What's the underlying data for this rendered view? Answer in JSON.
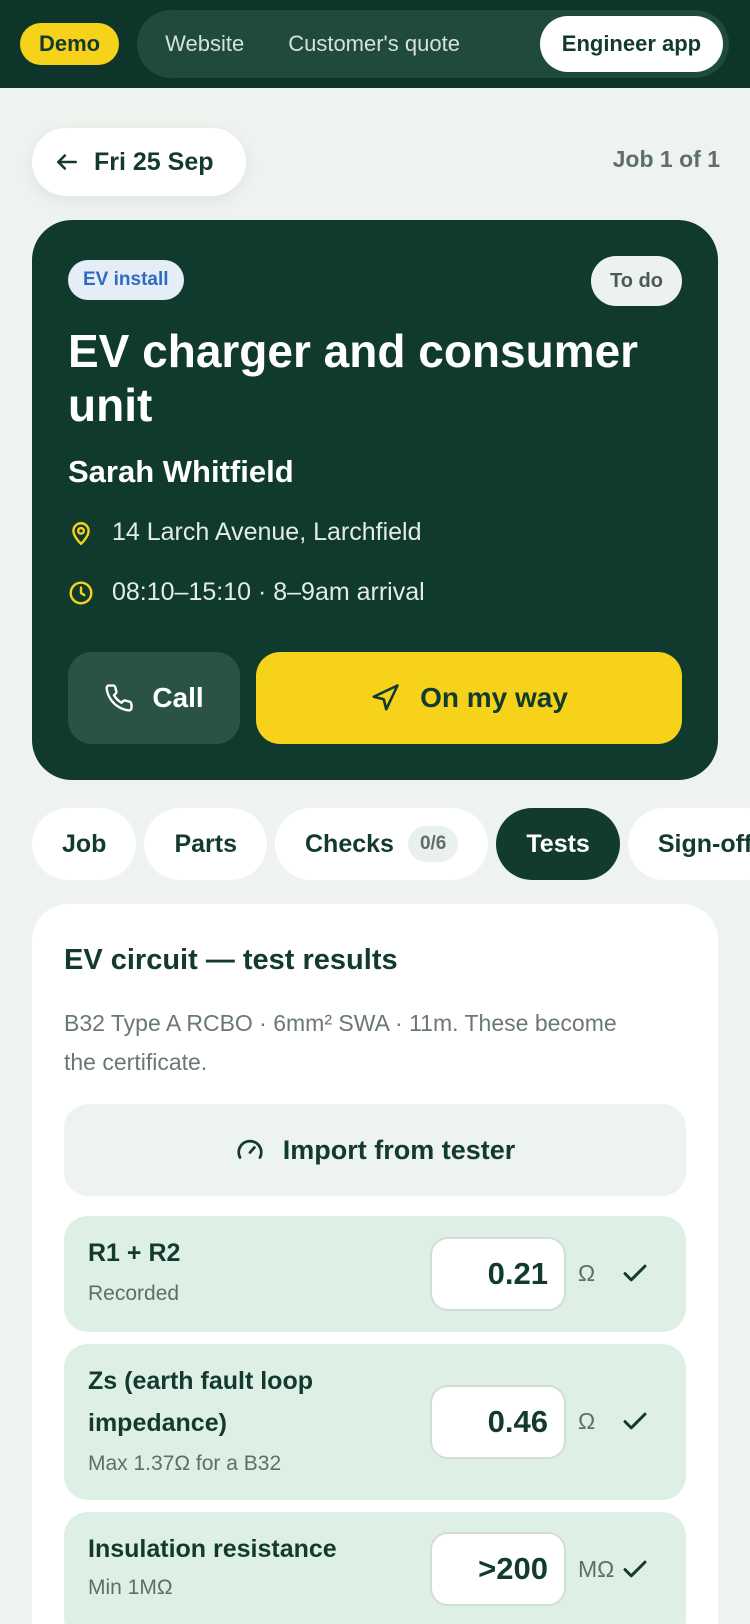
{
  "topbar": {
    "demo_label": "Demo",
    "segments": [
      "Website",
      "Customer's quote",
      "Engineer app"
    ],
    "active_segment": "Engineer app"
  },
  "header": {
    "back_label": "Fri 25 Sep",
    "job_count": "Job 1 of 1"
  },
  "job": {
    "type_badge": "EV install",
    "status": "To do",
    "title": "EV charger and consumer unit",
    "customer": "Sarah Whitfield",
    "address": "14 Larch Avenue, Larchfield",
    "time": "08:10–15:10 · 8–9am arrival",
    "call_label": "Call",
    "on_my_way_label": "On my way",
    "icons": {
      "address": "map-pin-icon",
      "time": "clock-icon",
      "call": "phone-icon",
      "on_my_way": "navigation-arrow-icon"
    }
  },
  "tabs": {
    "job": "Job",
    "parts": "Parts",
    "checks": "Checks",
    "checks_count": "0/6",
    "tests": "Tests",
    "signoff": "Sign-off",
    "active": "Tests"
  },
  "tests": {
    "title": "EV circuit — test results",
    "description": "B32 Type A RCBO · 6mm² SWA · 11m. These become the certificate.",
    "import_label": "Import from tester",
    "results": [
      {
        "name": "R1 + R2",
        "sub": "Recorded",
        "value": "0.21",
        "unit": "Ω",
        "passed": true
      },
      {
        "name": "Zs (earth fault loop impedance)",
        "sub": "Max 1.37Ω for a B32",
        "value": "0.46",
        "unit": "Ω",
        "passed": true
      },
      {
        "name": "Insulation resistance",
        "sub": "Min 1MΩ",
        "value": ">200",
        "unit": "MΩ",
        "passed": true
      }
    ]
  },
  "colors": {
    "dark_green": "#113a2e",
    "accent_yellow": "#f7d21a",
    "pass_green_bg": "#def0e5",
    "badge_blue": "#2f6cc0"
  }
}
